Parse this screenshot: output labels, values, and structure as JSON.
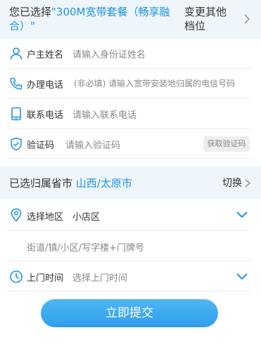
{
  "package": {
    "prefix": "您已选择",
    "name": "\"300M宽带套餐（畅享融合）\"",
    "change_label": "变更其他档位"
  },
  "form": {
    "name": {
      "label": "户主姓名",
      "placeholder": "请输入身份证姓名",
      "icon": "person-icon"
    },
    "handle_phone": {
      "label": "办理电话",
      "placeholder": "(非必填) 请输入宽带安装地归属的电信号码",
      "icon": "phone-icon"
    },
    "contact_phone": {
      "label": "联系电话",
      "placeholder": "请输入联系电话",
      "icon": "mobile-icon"
    },
    "code": {
      "label": "验证码",
      "placeholder": "请输入验证码",
      "button": "获取验证码",
      "icon": "shield-icon"
    }
  },
  "province": {
    "label": "已选归属省市",
    "value": "山西/太原市",
    "switch_label": "切换"
  },
  "address": {
    "district_label": "选择地区",
    "district_value": "小店区",
    "detail_placeholder": "街道/镇/小区/写字楼+门牌号",
    "time_label": "上门时间",
    "time_placeholder": "选择上门时间"
  },
  "submit_label": "立即提交",
  "colors": {
    "accent": "#1e94e0",
    "bar_bg": "#eef5fb",
    "button": "#3aa8ee"
  }
}
